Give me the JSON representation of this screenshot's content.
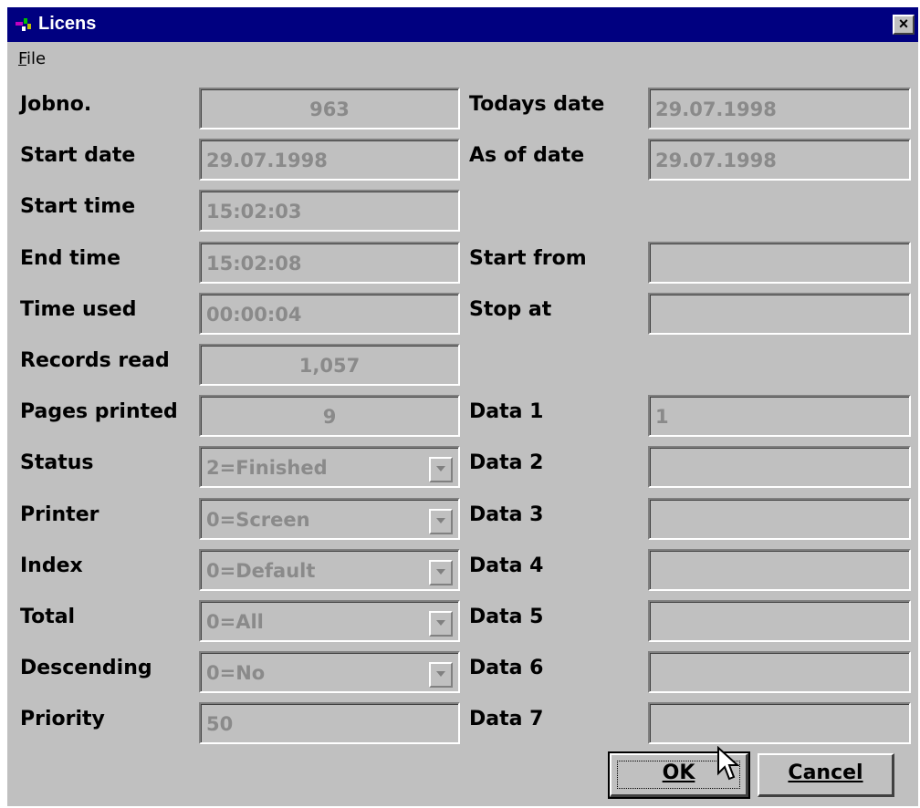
{
  "window": {
    "title": "Licens",
    "close_label": "×",
    "menu": {
      "file_label": "File"
    }
  },
  "left_fields": [
    {
      "label": "Jobno.",
      "value": "963",
      "align": "center",
      "dropdown": false
    },
    {
      "label": "Start date",
      "value": "29.07.1998",
      "align": "left",
      "dropdown": false
    },
    {
      "label": "Start time",
      "value": "15:02:03",
      "align": "left",
      "dropdown": false
    },
    {
      "label": "End time",
      "value": "15:02:08",
      "align": "left",
      "dropdown": false
    },
    {
      "label": "Time used",
      "value": "00:00:04",
      "align": "left",
      "dropdown": false
    },
    {
      "label": "Records read",
      "value": "1,057",
      "align": "center",
      "dropdown": false
    },
    {
      "label": "Pages printed",
      "value": "9",
      "align": "center",
      "dropdown": false
    },
    {
      "label": "Status",
      "value": "2=Finished",
      "align": "left",
      "dropdown": true
    },
    {
      "label": "Printer",
      "value": "0=Screen",
      "align": "left",
      "dropdown": true
    },
    {
      "label": "Index",
      "value": "0=Default",
      "align": "left",
      "dropdown": true
    },
    {
      "label": "Total",
      "value": "0=All",
      "align": "left",
      "dropdown": true
    },
    {
      "label": "Descending",
      "value": "0=No",
      "align": "left",
      "dropdown": true
    },
    {
      "label": "Priority",
      "value": "50",
      "align": "left",
      "dropdown": false
    }
  ],
  "right_fields": [
    {
      "label": "Todays date",
      "value": "29.07.1998",
      "row": 0
    },
    {
      "label": "As of date",
      "value": "29.07.1998",
      "row": 1
    },
    {
      "label": "Start from",
      "value": "",
      "row": 3
    },
    {
      "label": "Stop at",
      "value": "",
      "row": 4
    },
    {
      "label": "Data 1",
      "value": "1",
      "row": 6
    },
    {
      "label": "Data 2",
      "value": "",
      "row": 7
    },
    {
      "label": "Data 3",
      "value": "",
      "row": 8
    },
    {
      "label": "Data 4",
      "value": "",
      "row": 9
    },
    {
      "label": "Data 5",
      "value": "",
      "row": 10
    },
    {
      "label": "Data 6",
      "value": "",
      "row": 11
    },
    {
      "label": "Data 7",
      "value": "",
      "row": 12
    }
  ],
  "buttons": {
    "ok_label": "OK",
    "cancel_label": "Cancel"
  },
  "colors": {
    "titlebar": "#000080",
    "face": "#c0c0c0",
    "disabled_text": "#8a8a8a"
  }
}
